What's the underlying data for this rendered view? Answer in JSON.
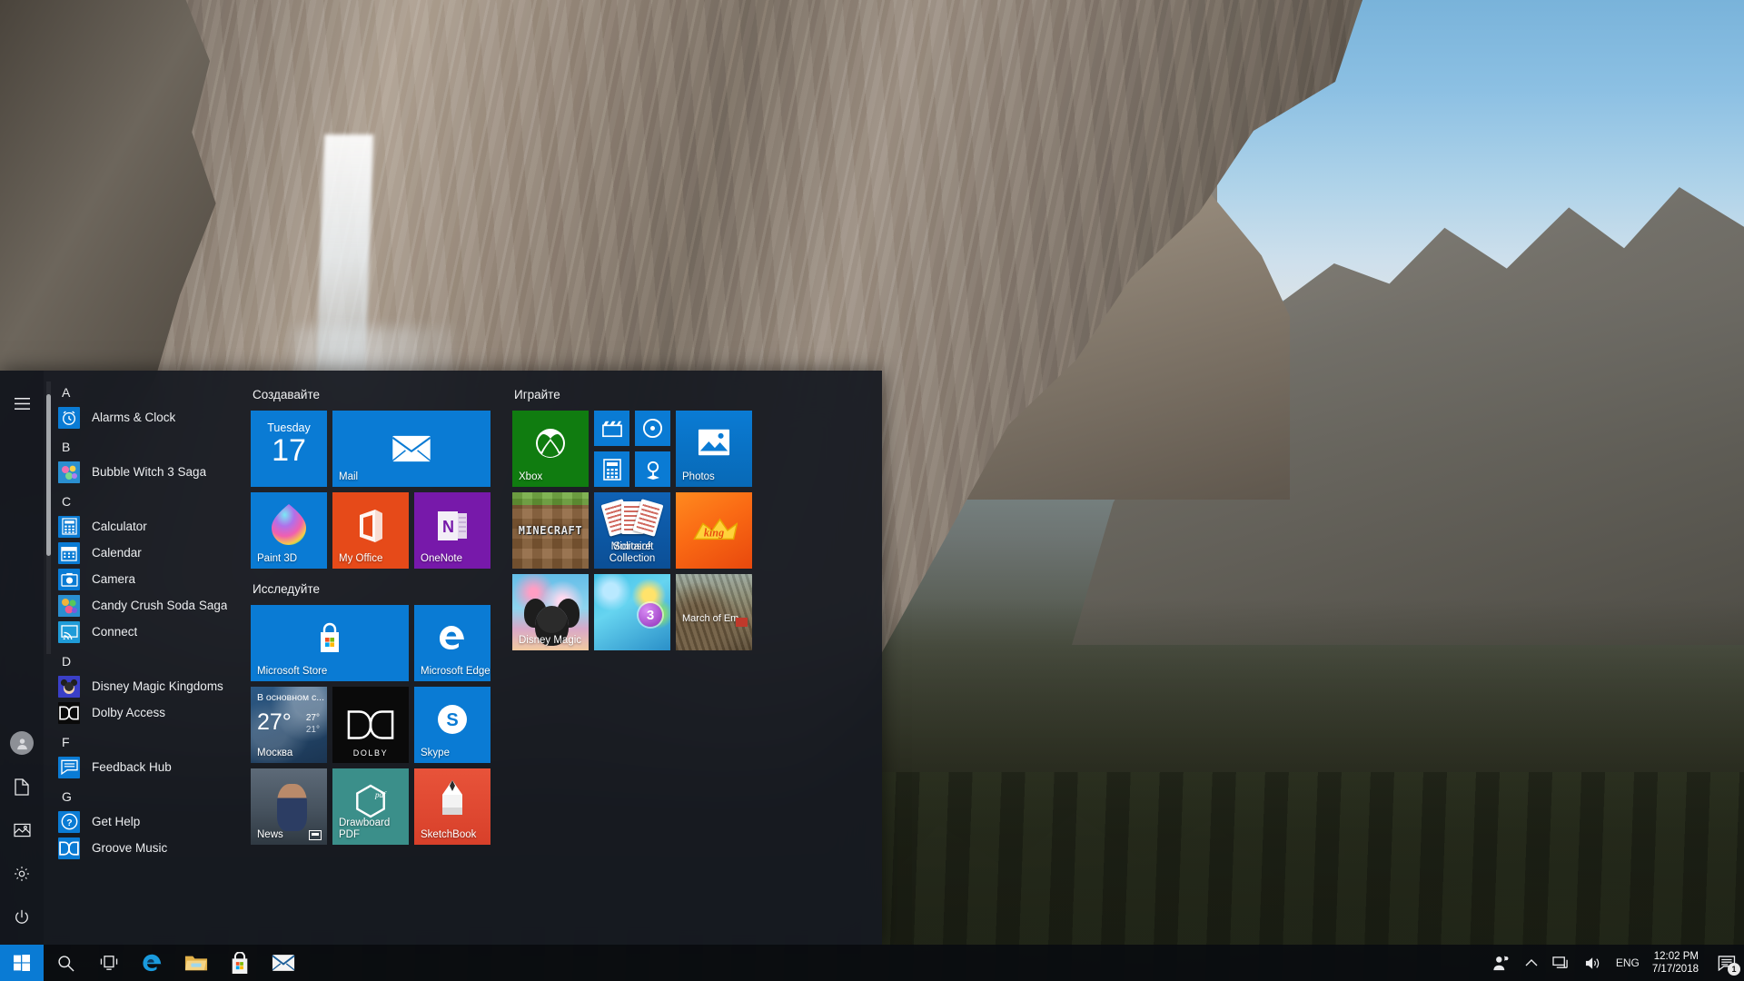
{
  "desktop": {
    "wallpaper_name": "yosemite-cliff-wallpaper"
  },
  "start_menu": {
    "rail": {
      "hamburger_label": "Start",
      "items": [
        {
          "name": "hamburger-icon",
          "label": "Expand"
        },
        {
          "name": "user-account-icon",
          "label": "User"
        },
        {
          "name": "documents-icon",
          "label": "Documents"
        },
        {
          "name": "pictures-icon",
          "label": "Pictures"
        },
        {
          "name": "settings-icon",
          "label": "Settings"
        },
        {
          "name": "power-icon",
          "label": "Power"
        }
      ]
    },
    "app_list": [
      {
        "type": "letter",
        "label": "A"
      },
      {
        "type": "app",
        "label": "Alarms & Clock",
        "icon": "alarm-clock-icon",
        "color": "#0a7bd4"
      },
      {
        "type": "letter",
        "label": "B"
      },
      {
        "type": "app",
        "label": "Bubble Witch 3 Saga",
        "icon": "bubble-witch-icon",
        "color": "#1f7fc4"
      },
      {
        "type": "letter",
        "label": "C"
      },
      {
        "type": "app",
        "label": "Calculator",
        "icon": "calculator-icon",
        "color": "#0a7bd4"
      },
      {
        "type": "app",
        "label": "Calendar",
        "icon": "calendar-icon",
        "color": "#0a7bd4"
      },
      {
        "type": "app",
        "label": "Camera",
        "icon": "camera-icon",
        "color": "#0a7bd4"
      },
      {
        "type": "app",
        "label": "Candy Crush Soda Saga",
        "icon": "candy-crush-icon",
        "color": "#2a8fd0"
      },
      {
        "type": "app",
        "label": "Connect",
        "icon": "connect-cast-icon",
        "color": "#1f9bd8"
      },
      {
        "type": "letter",
        "label": "D"
      },
      {
        "type": "app",
        "label": "Disney Magic Kingdoms",
        "icon": "disney-magic-icon",
        "color": "#2b2fa8"
      },
      {
        "type": "app",
        "label": "Dolby Access",
        "icon": "dolby-icon",
        "color": "#0a0a0a"
      },
      {
        "type": "letter",
        "label": "F"
      },
      {
        "type": "app",
        "label": "Feedback Hub",
        "icon": "feedback-hub-icon",
        "color": "#0a7bd4"
      },
      {
        "type": "letter",
        "label": "G"
      },
      {
        "type": "app",
        "label": "Get Help",
        "icon": "get-help-icon",
        "color": "#0a7bd4"
      },
      {
        "type": "app",
        "label": "Groove Music",
        "icon": "groove-music-icon",
        "color": "#0a7bd4"
      }
    ],
    "tile_groups": [
      {
        "title": "Создавайте",
        "tiles": [
          {
            "name": "calendar-tile",
            "label": "",
            "day": "Tuesday",
            "date": "17",
            "size": "medium",
            "art": "cal"
          },
          {
            "name": "mail-tile",
            "label": "Mail",
            "size": "wide",
            "art": "mail",
            "glyph": "envelope"
          },
          {
            "name": "paint3d-tile",
            "label": "Paint 3D",
            "size": "medium",
            "art": "paint3d",
            "glyph": "paint-blob"
          },
          {
            "name": "my-office-tile",
            "label": "My Office",
            "size": "medium",
            "art": "office",
            "glyph": "office-logo"
          },
          {
            "name": "onenote-tile",
            "label": "OneNote",
            "size": "medium",
            "art": "onenote",
            "glyph": "onenote-logo"
          }
        ]
      },
      {
        "title": "Исследуйте",
        "tiles": [
          {
            "name": "microsoft-store-tile",
            "label": "Microsoft Store",
            "size": "wide",
            "art": "store",
            "glyph": "store-bag"
          },
          {
            "name": "microsoft-edge-tile",
            "label": "Microsoft Edge",
            "size": "medium",
            "art": "edge",
            "glyph": "edge-logo"
          },
          {
            "name": "weather-tile",
            "label": "Москва",
            "condition": "В основном с...",
            "temp": "27°",
            "high": "27°",
            "low": "21°",
            "size": "medium",
            "art": "weather"
          },
          {
            "name": "dolby-tile",
            "label": "",
            "size": "medium",
            "art": "dolby",
            "glyph": "dolby-logo"
          },
          {
            "name": "skype-tile",
            "label": "Skype",
            "size": "medium",
            "art": "skype",
            "glyph": "skype-logo"
          },
          {
            "name": "news-tile",
            "label": "News",
            "size": "medium",
            "art": "news"
          },
          {
            "name": "drawboard-pdf-tile",
            "label": "Drawboard PDF",
            "size": "medium",
            "art": "drawboard",
            "glyph": "hexagon-pdf"
          },
          {
            "name": "sketchbook-tile",
            "label": "SketchBook",
            "size": "medium",
            "art": "skbk",
            "glyph": "pencil"
          }
        ]
      },
      {
        "title": "Играйте",
        "tiles": [
          {
            "name": "xbox-tile",
            "label": "Xbox",
            "size": "medium",
            "art": "xbox",
            "glyph": "xbox-logo"
          },
          {
            "name": "movies-tv-tile",
            "label": "",
            "size": "small",
            "art": "sm-blue",
            "glyph": "clapperboard-icon"
          },
          {
            "name": "groove-music-tile",
            "label": "",
            "size": "small",
            "art": "sm-blue",
            "glyph": "disc-icon"
          },
          {
            "name": "calculator-tile",
            "label": "",
            "size": "small",
            "art": "sm-blue",
            "glyph": "calculator-icon"
          },
          {
            "name": "maps-tile",
            "label": "",
            "size": "small",
            "art": "sm-blue",
            "glyph": "map-pin-icon"
          },
          {
            "name": "photos-tile",
            "label": "Photos",
            "size": "medium",
            "art": "photos",
            "glyph": "photo-icon"
          },
          {
            "name": "minecraft-tile",
            "label": "",
            "word": "MINECRAFT",
            "size": "medium",
            "art": "mine"
          },
          {
            "name": "solitaire-tile",
            "label": "Microsoft\nSolitaire Collection",
            "label_line1": "Microsoft",
            "label_line2": "Solitaire Collection",
            "size": "medium",
            "art": "solitaire"
          },
          {
            "name": "king-tile",
            "label": "",
            "size": "medium",
            "art": "king",
            "glyph": "king-logo"
          },
          {
            "name": "disney-magic-tile",
            "label": "Disney Magic",
            "size": "medium",
            "art": "disney"
          },
          {
            "name": "bubble-witch-tile",
            "label": "",
            "size": "medium",
            "art": "bubble"
          },
          {
            "name": "march-of-empires-tile",
            "label": "March of Em",
            "size": "medium",
            "art": "march"
          }
        ]
      }
    ]
  },
  "taskbar": {
    "start_label": "Start",
    "pinned": [
      {
        "name": "search-icon",
        "label": "Search"
      },
      {
        "name": "task-view-icon",
        "label": "Task View"
      },
      {
        "name": "microsoft-edge-icon",
        "label": "Microsoft Edge"
      },
      {
        "name": "file-explorer-icon",
        "label": "File Explorer"
      },
      {
        "name": "microsoft-store-icon",
        "label": "Microsoft Store"
      },
      {
        "name": "mail-icon",
        "label": "Mail"
      }
    ],
    "tray": {
      "people_label": "People",
      "chevron_label": "Show hidden icons",
      "network_label": "Network",
      "volume_label": "Volume",
      "language": "ENG",
      "time": "12:02 PM",
      "date": "7/17/2018",
      "notifications_count": "1"
    }
  }
}
